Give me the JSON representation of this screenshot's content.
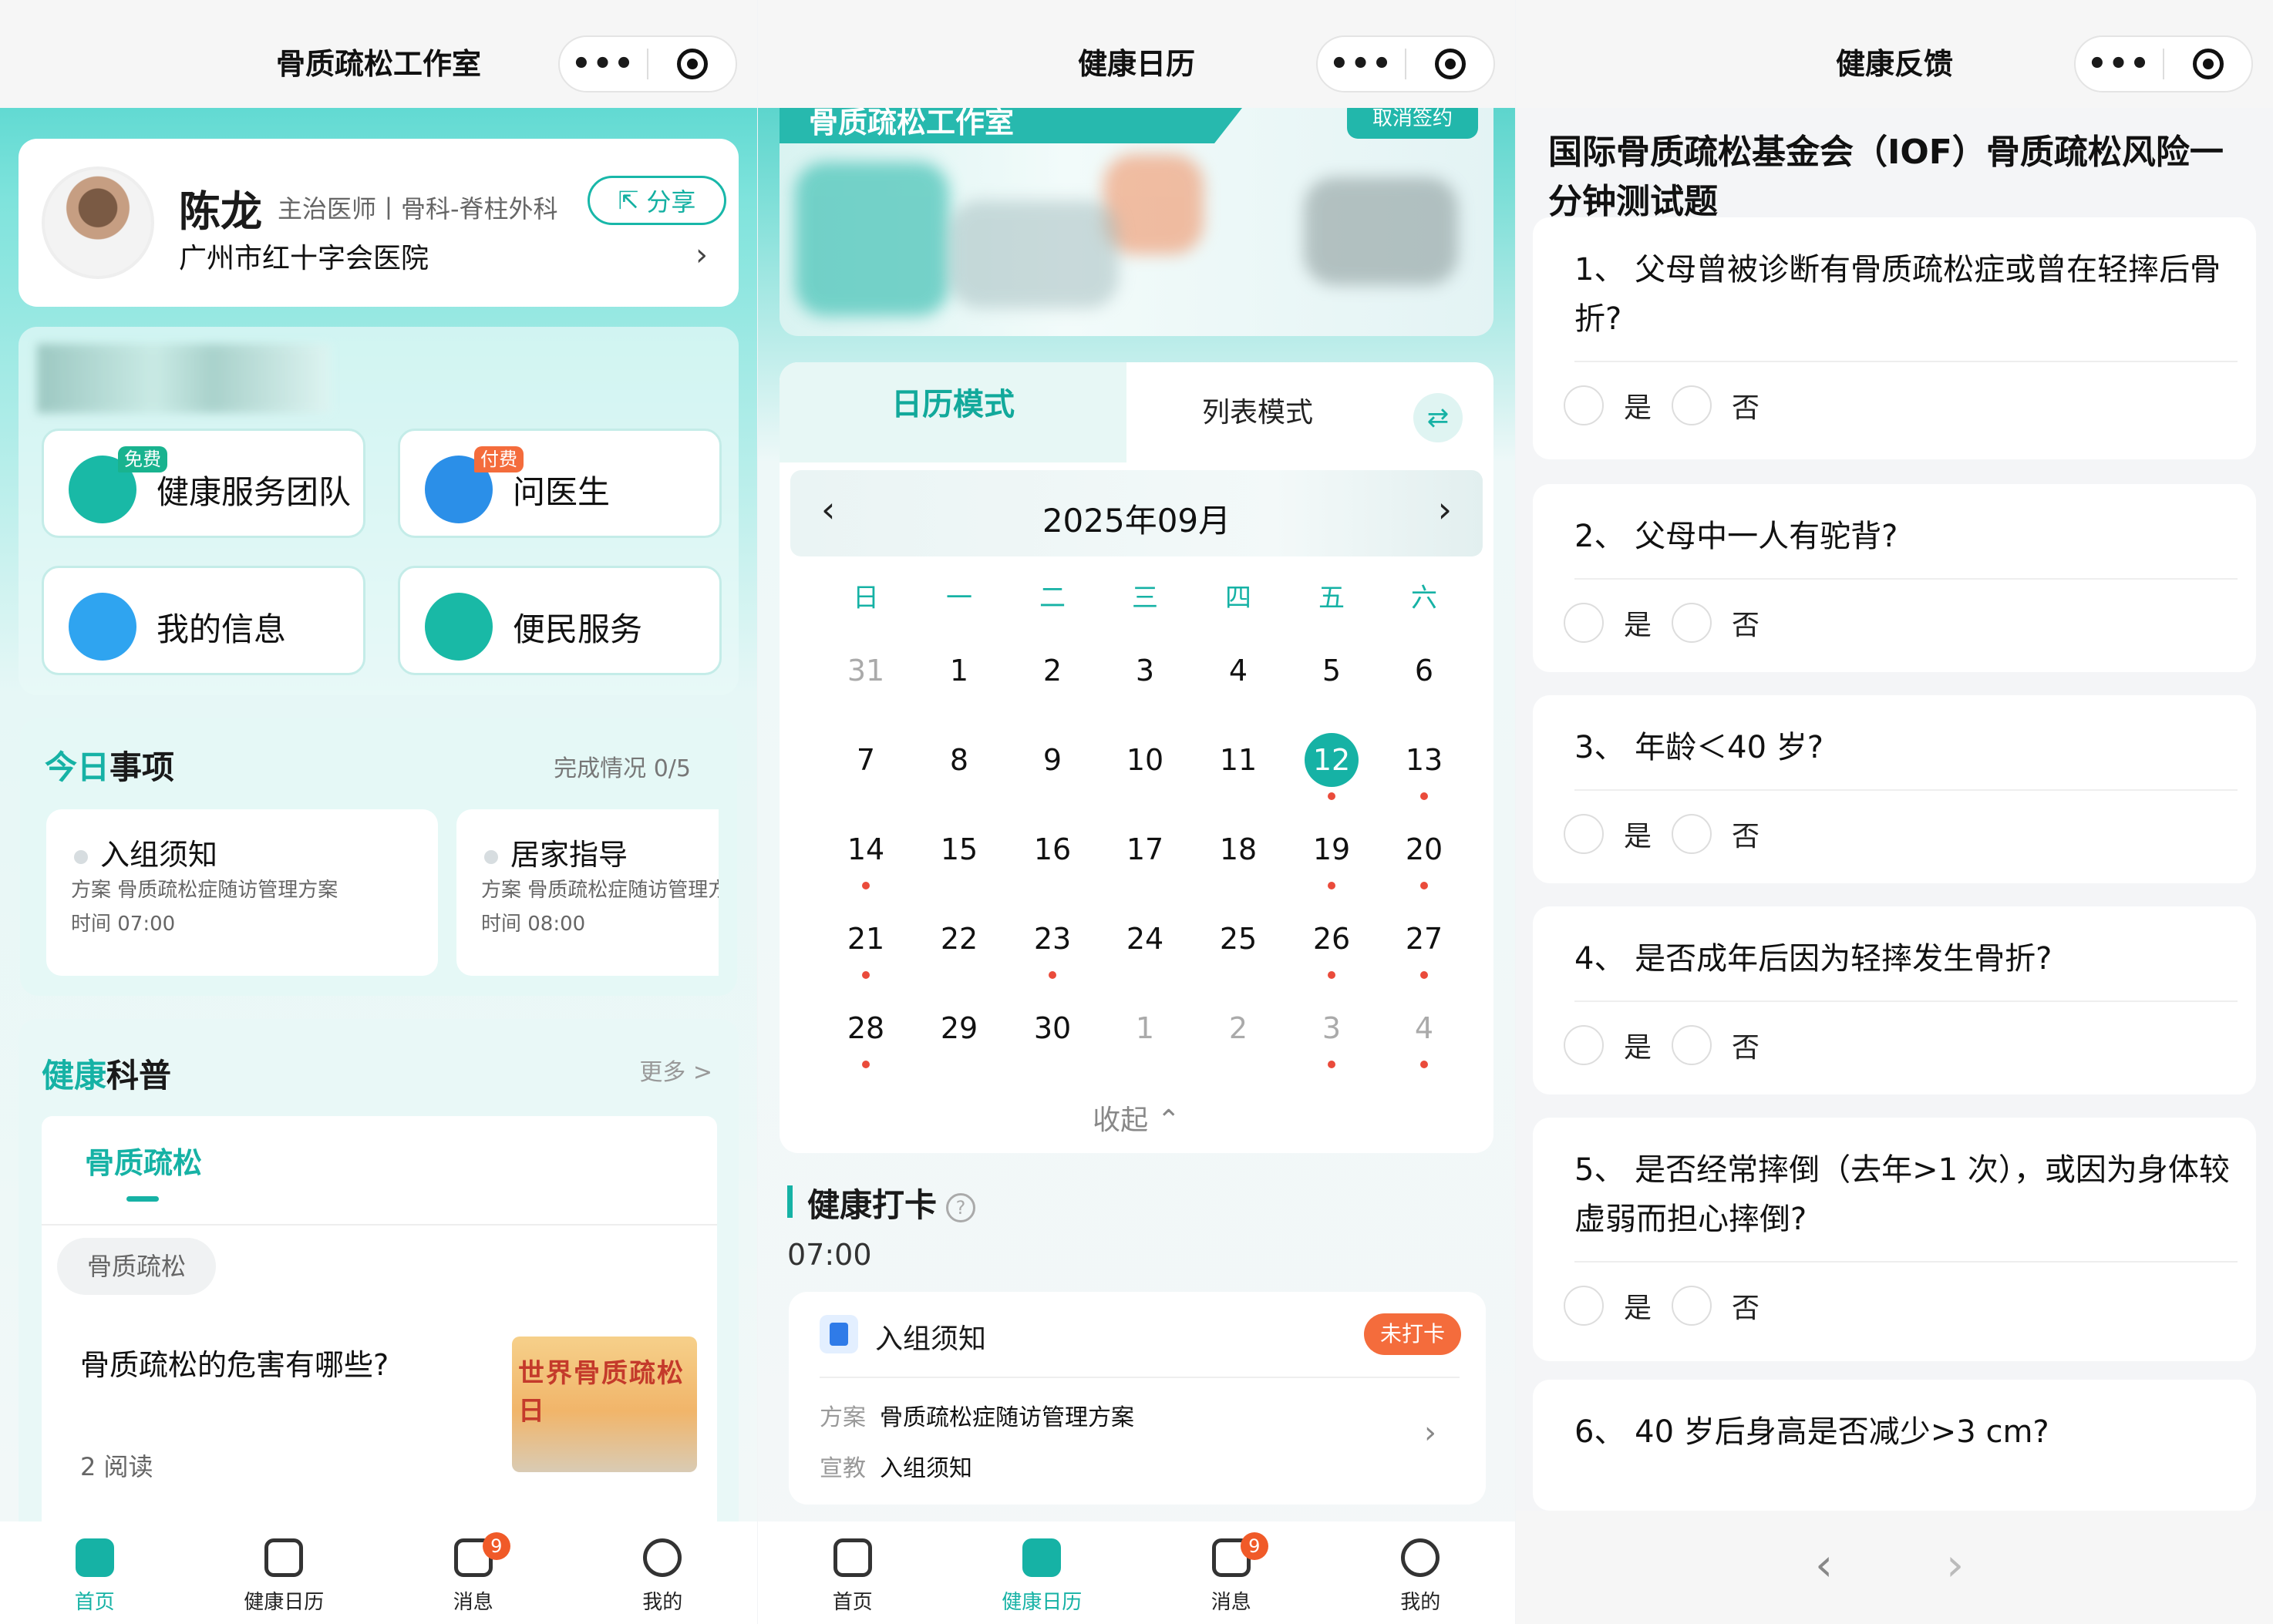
{
  "panel1": {
    "title": "骨质疏松工作室",
    "doctor": {
      "name": "陈龙",
      "title": "主治医师丨骨科-脊柱外科",
      "hospital": "广州市红十字会医院",
      "share_label": "分享"
    },
    "services": [
      {
        "label": "健康服务团队",
        "tag": "免费",
        "tag_color": "#19b38f"
      },
      {
        "label": "问医生",
        "tag": "付费",
        "tag_color": "#f46c3c"
      },
      {
        "label": "我的信息",
        "tag": ""
      },
      {
        "label": "便民服务",
        "tag": ""
      }
    ],
    "today": {
      "title_a": "今日",
      "title_b": "事项",
      "progress": "完成情况 0/5",
      "tasks": [
        {
          "title": "入组须知",
          "plan": "方案 骨质疏松症随访管理方案",
          "time": "时间 07:00"
        },
        {
          "title": "居家指导",
          "plan": "方案 骨质疏松症随访管理方案",
          "time": "时间 08:00"
        }
      ]
    },
    "science": {
      "title_a": "健康",
      "title_b": "科普",
      "more": "更多 >",
      "tab": "骨质疏松",
      "chip": "骨质疏松",
      "article": {
        "title": "骨质疏松的危害有哪些?",
        "reads": "2 阅读",
        "image_text": "世界骨质疏松日"
      }
    }
  },
  "tabbar": {
    "items": [
      "首页",
      "健康日历",
      "消息",
      "我的"
    ],
    "badge": "9"
  },
  "panel2": {
    "title": "健康日历",
    "hero": {
      "name": "骨质疏松工作室",
      "cancel_label": "取消签约"
    },
    "modes": {
      "calendar": "日历模式",
      "list": "列表模式",
      "swap_icon": "⇄"
    },
    "month": "2025年09月",
    "weekdays": [
      "日",
      "一",
      "二",
      "三",
      "四",
      "五",
      "六"
    ],
    "weeks": [
      [
        "31",
        "1",
        "2",
        "3",
        "4",
        "5",
        "6"
      ],
      [
        "7",
        "8",
        "9",
        "10",
        "11",
        "12",
        "13"
      ],
      [
        "14",
        "15",
        "16",
        "17",
        "18",
        "19",
        "20"
      ],
      [
        "21",
        "22",
        "23",
        "24",
        "25",
        "26",
        "27"
      ],
      [
        "28",
        "29",
        "30",
        "1",
        "2",
        "3",
        "4"
      ]
    ],
    "selected_day": "12",
    "collapse_label": "收起",
    "checkin": {
      "section": "健康打卡",
      "time": "07:00",
      "item": {
        "title": "入组须知",
        "status": "未打卡",
        "plan_label": "方案",
        "plan": "骨质疏松症随访管理方案",
        "edu_label": "宣教",
        "edu": "入组须知"
      }
    }
  },
  "panel3": {
    "title": "健康反馈",
    "heading": "国际骨质疏松基金会（IOF）骨质疏松风险一分钟测试题",
    "options": [
      "是",
      "否"
    ],
    "questions": [
      "1、 父母曾被诊断有骨质疏松症或曾在轻摔后骨折?",
      "2、 父母中一人有驼背?",
      "3、 年龄＜40 岁?",
      "4、 是否成年后因为轻摔发生骨折?",
      "5、 是否经常摔倒（去年>1 次），或因为身体较虚弱而担心摔倒?",
      "6、 40 岁后身高是否减少>3 cm?"
    ]
  },
  "colors": {
    "accent": "#16b2a5",
    "alert": "#f46c3c",
    "dot": "#ea4b3b"
  }
}
